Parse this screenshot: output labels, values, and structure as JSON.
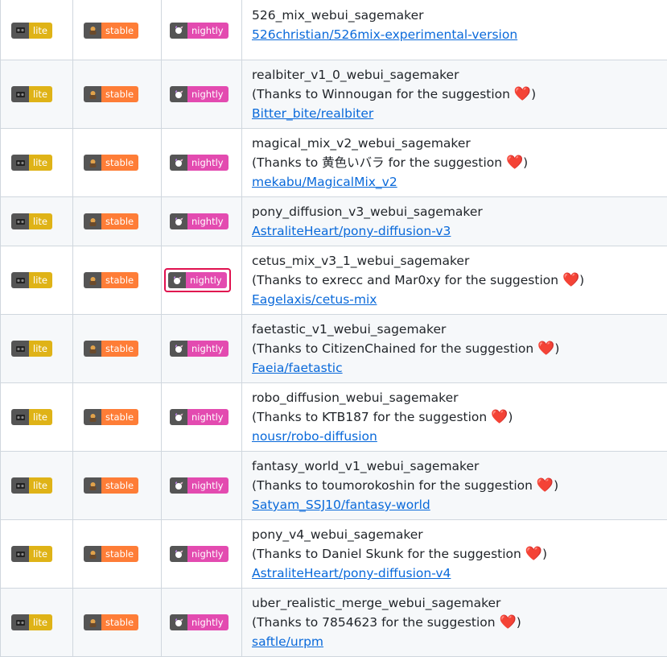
{
  "badges": {
    "lite": "lite",
    "stable": "stable",
    "nightly": "nightly"
  },
  "colors": {
    "lite": "#dfb317",
    "stable": "#fe7d37",
    "nightly": "#e34bb0",
    "link": "#0969da",
    "highlight": "#e0114f"
  },
  "thanks_prefix": "(Thanks to ",
  "thanks_suffix": " for the suggestion ",
  "close_paren": ")",
  "heart": "❤️",
  "rows": [
    {
      "name": "526_mix_webui_sagemaker",
      "thanks": "",
      "link": "526christian/526mix-experimental-version"
    },
    {
      "name": "realbiter_v1_0_webui_sagemaker",
      "thanks": "Winnougan",
      "link": "Bitter_bite/realbiter"
    },
    {
      "name": "magical_mix_v2_webui_sagemaker",
      "thanks": "黄色いバラ",
      "link": "mekabu/MagicalMix_v2"
    },
    {
      "name": "pony_diffusion_v3_webui_sagemaker",
      "thanks": "",
      "link": "AstraliteHeart/pony-diffusion-v3"
    },
    {
      "name": "cetus_mix_v3_1_webui_sagemaker",
      "thanks": "exrecc and Mar0xy",
      "link": "Eagelaxis/cetus-mix"
    },
    {
      "name": "faetastic_v1_webui_sagemaker",
      "thanks": "CitizenChained",
      "link": "Faeia/faetastic"
    },
    {
      "name": "robo_diffusion_webui_sagemaker",
      "thanks": "KTB187",
      "link": "nousr/robo-diffusion"
    },
    {
      "name": "fantasy_world_v1_webui_sagemaker",
      "thanks": "toumorokoshin",
      "link": "Satyam_SSJ10/fantasy-world"
    },
    {
      "name": "pony_v4_webui_sagemaker",
      "thanks": "Daniel Skunk",
      "link": "AstraliteHeart/pony-diffusion-v4"
    },
    {
      "name": "uber_realistic_merge_webui_sagemaker",
      "thanks": "7854623",
      "link": "saftle/urpm"
    }
  ]
}
